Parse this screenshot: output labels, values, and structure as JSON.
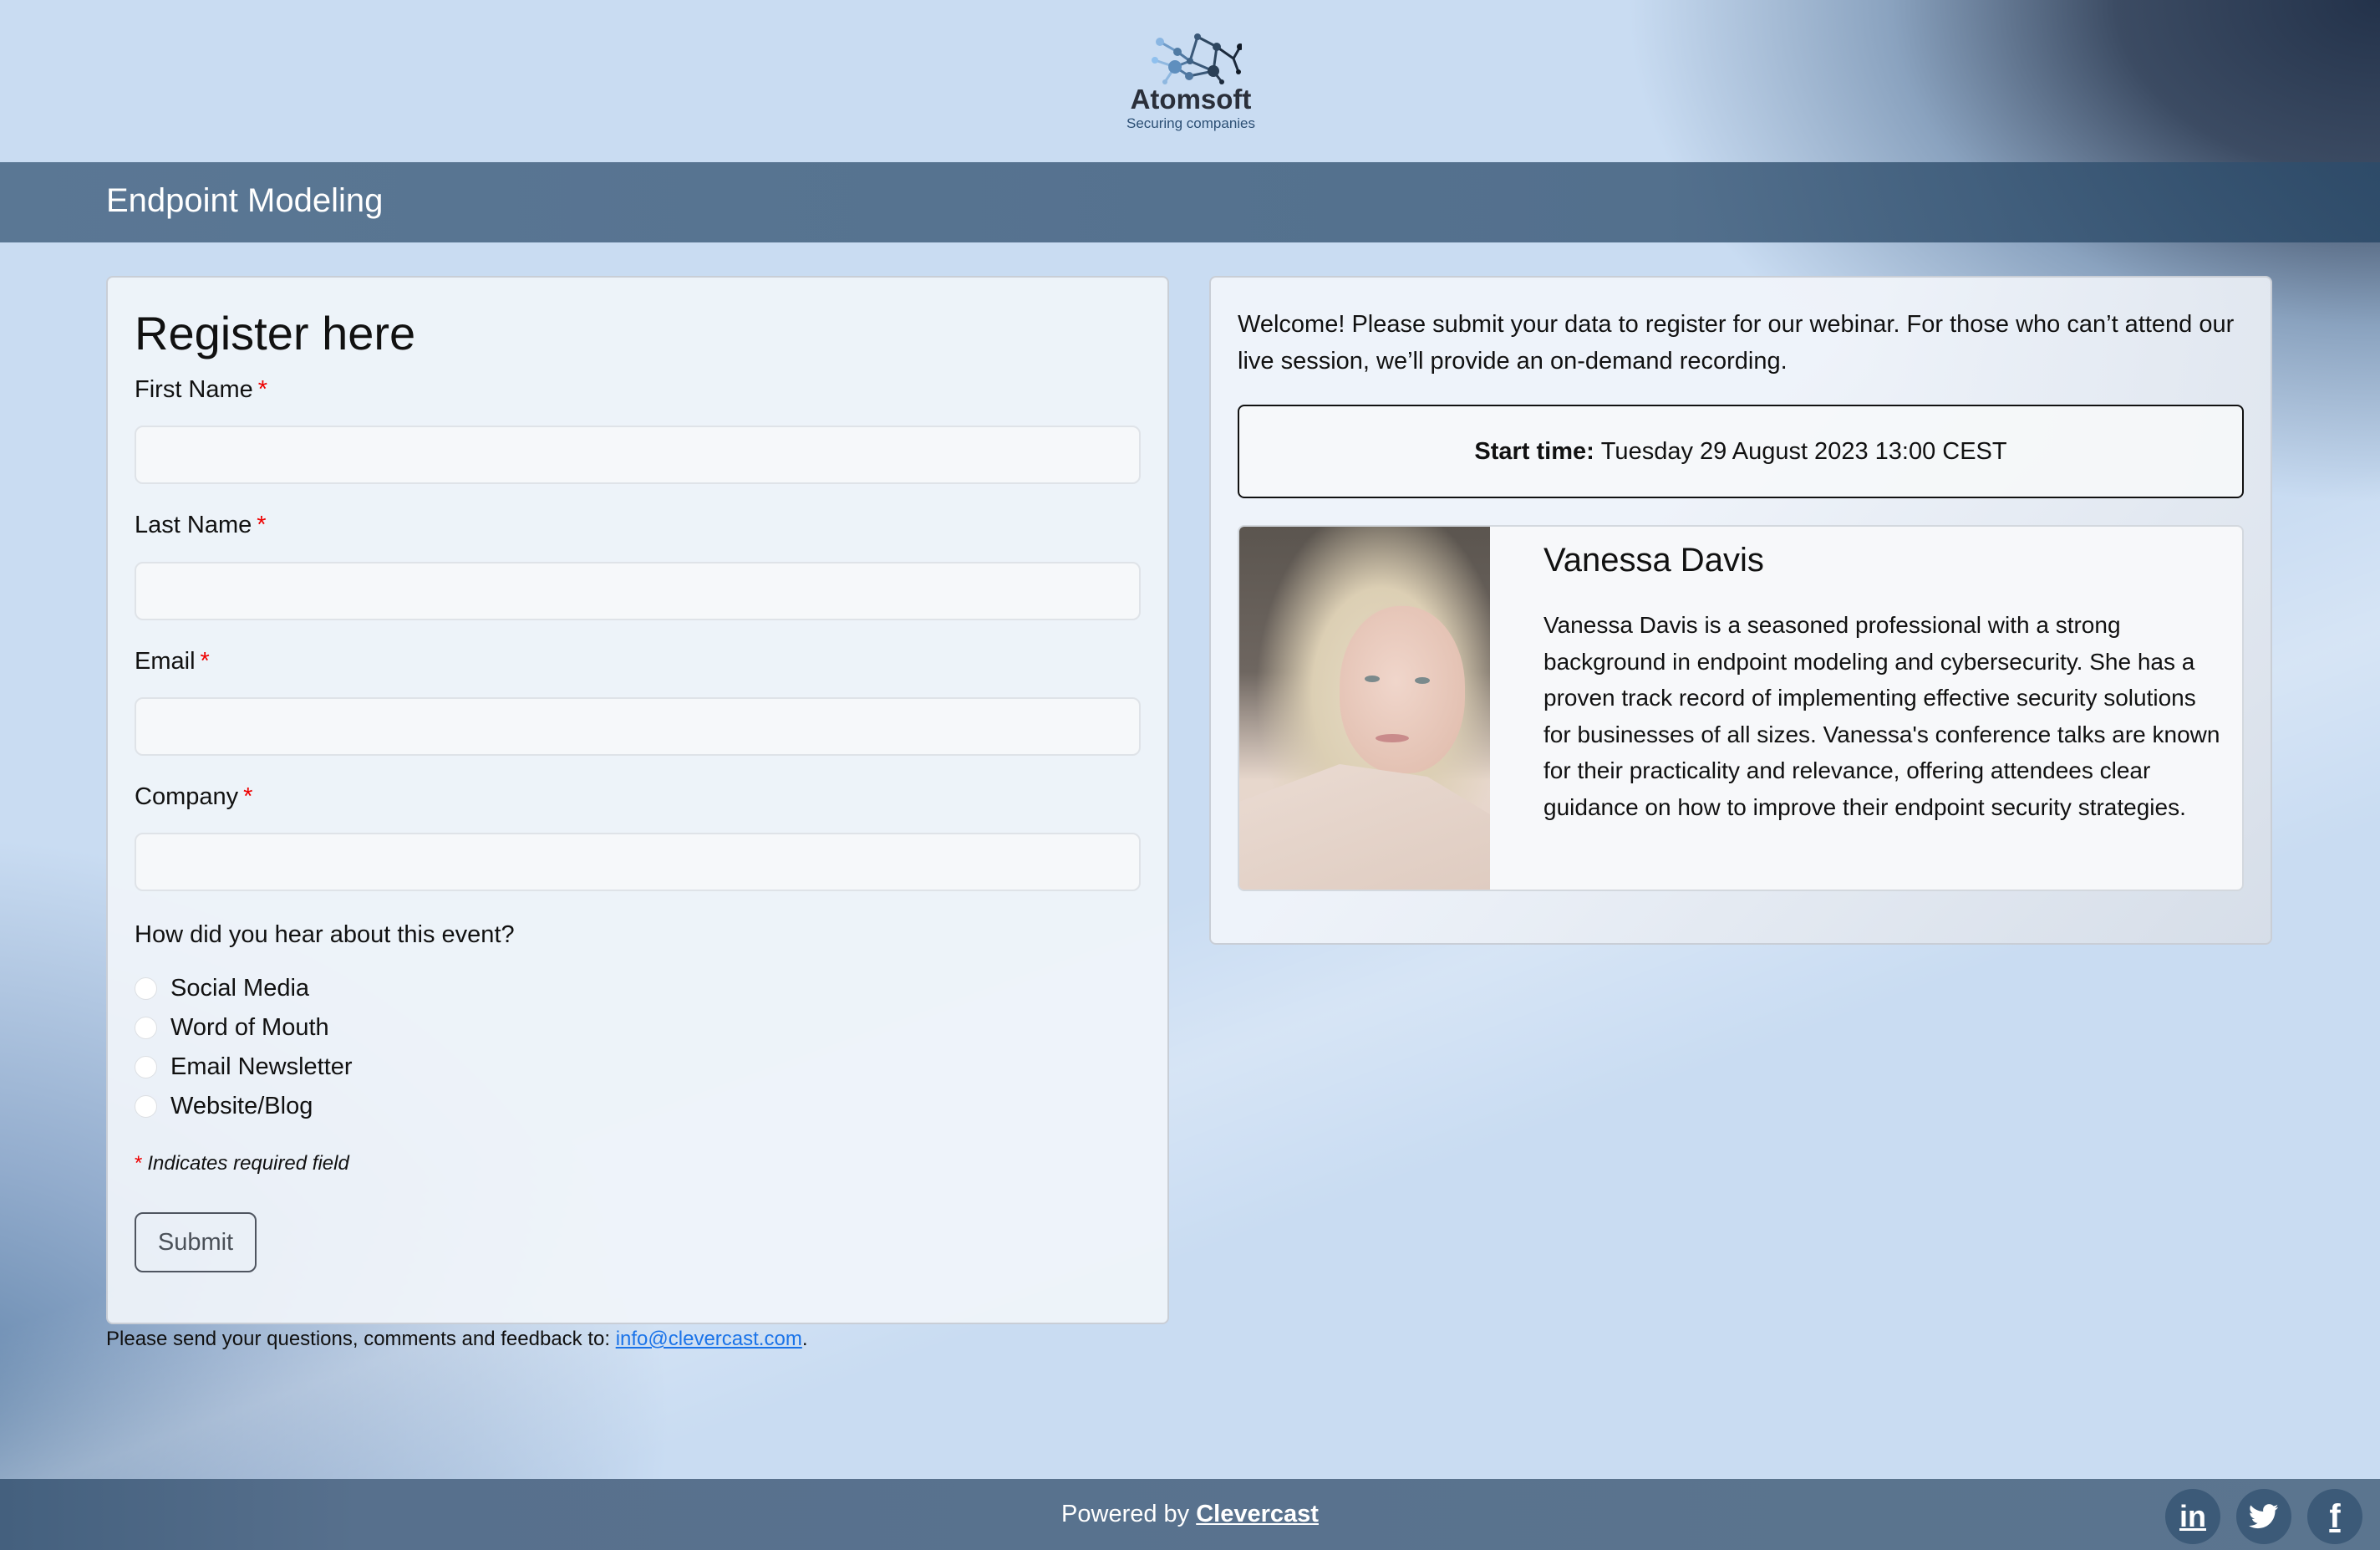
{
  "brand": {
    "name": "Atomsoft",
    "tagline": "Securing companies",
    "logo_icon": "molecule-network-icon"
  },
  "header": {
    "title": "Endpoint Modeling"
  },
  "form": {
    "title": "Register here",
    "fields": [
      {
        "label": "First Name",
        "required_mark": "*",
        "value": "",
        "placeholder": ""
      },
      {
        "label": "Last Name",
        "required_mark": "*",
        "value": "",
        "placeholder": ""
      },
      {
        "label": "Email",
        "required_mark": "*",
        "value": "",
        "placeholder": ""
      },
      {
        "label": "Company",
        "required_mark": "*",
        "value": "",
        "placeholder": ""
      }
    ],
    "question": "How did you hear about this event?",
    "options": [
      {
        "label": "Social Media",
        "selected": false
      },
      {
        "label": "Word of Mouth",
        "selected": false
      },
      {
        "label": "Email Newsletter",
        "selected": false
      },
      {
        "label": "Website/Blog",
        "selected": false
      }
    ],
    "required_note_mark": "*",
    "required_note": "Indicates required field",
    "submit_label": "Submit"
  },
  "contact": {
    "text": "Please send your questions, comments and feedback to: ",
    "email": "info@clevercast.com",
    "suffix": "."
  },
  "info": {
    "welcome": "Welcome! Please submit your data to register for our webinar. For those who can’t attend our live session, we’ll provide an on-demand recording.",
    "start_label": "Start time:",
    "start_value": "Tuesday 29 August 2023 13:00 CEST"
  },
  "speaker": {
    "name": "Vanessa Davis",
    "bio": "Vanessa Davis is a seasoned professional with a strong background in endpoint modeling and cybersecurity. She has a proven track record of implementing effective security solutions for businesses of all sizes. Vanessa's conference talks are known for their practicality and relevance, offering attendees clear guidance on how to improve their endpoint security strategies.",
    "photo_alt": "speaker-photo"
  },
  "footer": {
    "powered_by": "Powered by ",
    "brand_link": "Clevercast",
    "social": [
      {
        "name": "linkedin",
        "glyph": "in"
      },
      {
        "name": "twitter",
        "glyph": "twitter-bird"
      },
      {
        "name": "facebook",
        "glyph": "f"
      }
    ]
  },
  "colors": {
    "header_bar": "#587390",
    "footer_bar": "#587390",
    "required_red": "#e00000",
    "link_blue": "#1a73e8",
    "social_circle": "#3c5a78"
  }
}
